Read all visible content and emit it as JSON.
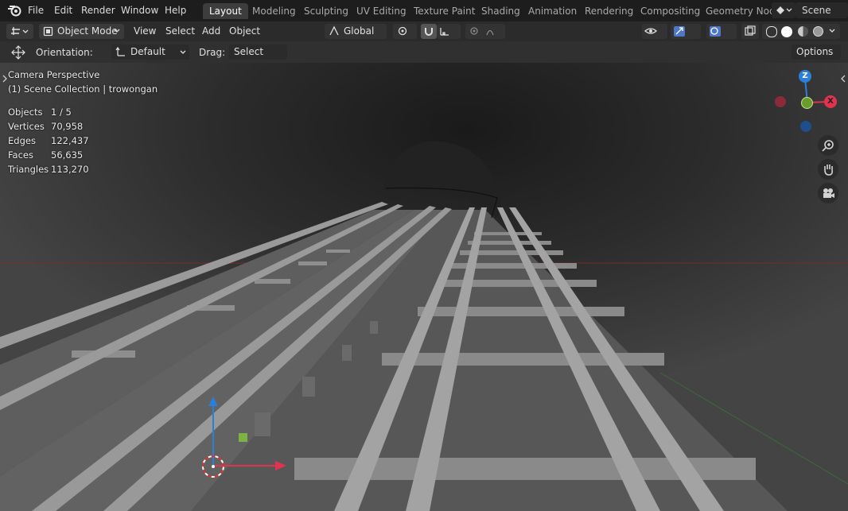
{
  "menu": {
    "file": "File",
    "edit": "Edit",
    "render": "Render",
    "window": "Window",
    "help": "Help"
  },
  "workspaces": [
    "Layout",
    "Modeling",
    "Sculpting",
    "UV Editing",
    "Texture Paint",
    "Shading",
    "Animation",
    "Rendering",
    "Compositing",
    "Geometry Nod"
  ],
  "scene": "Scene",
  "header": {
    "mode": "Object Mode",
    "view": "View",
    "select": "Select",
    "add": "Add",
    "object": "Object",
    "transform": "Global"
  },
  "toolrow": {
    "orientation_label": "Orientation:",
    "orientation_value": "Default",
    "drag_label": "Drag:",
    "drag_value": "Select Box",
    "options": "Options"
  },
  "viewport": {
    "camera": "Camera Perspective",
    "collection": "(1) Scene Collection | trowongan",
    "stats": [
      {
        "label": "Objects",
        "value": "1 / 5"
      },
      {
        "label": "Vertices",
        "value": "70,958"
      },
      {
        "label": "Edges",
        "value": "122,437"
      },
      {
        "label": "Faces",
        "value": "56,635"
      },
      {
        "label": "Triangles",
        "value": "113,270"
      }
    ]
  },
  "gizmo": {
    "z": "Z",
    "x": "X"
  },
  "colors": {
    "x_axis": "#e0344e",
    "y_axis": "#8bc34a",
    "z_axis": "#2b7fd9",
    "viewport_bg": "#3e3e3e",
    "active_tab": "#3d3d3d"
  }
}
